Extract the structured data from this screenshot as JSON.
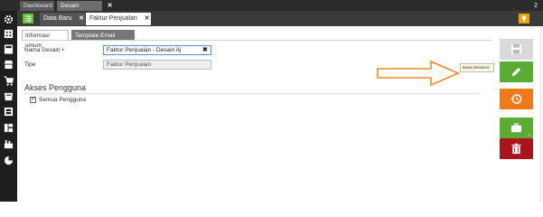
{
  "topbar": {
    "tabs": [
      {
        "label": "Dashboard"
      },
      {
        "label": "Desain Cetakan"
      }
    ],
    "close_label": "✕",
    "right_text": "2"
  },
  "secondbar": {
    "tabs": [
      {
        "label": "Data Baru",
        "close": "✕"
      },
      {
        "label": "Faktur Penjualan ...",
        "close": "✕"
      }
    ]
  },
  "subtabs": [
    {
      "label": "Informasi umum"
    },
    {
      "label": "Template Email Transaksi"
    }
  ],
  "form": {
    "nama_desain": {
      "label": "Nama Desain",
      "required_mark": "•",
      "value": "Faktur Penjualan - Desain A|",
      "clear": "✖"
    },
    "tipe": {
      "label": "Tipe",
      "value": "Faktur Penjualan"
    }
  },
  "access": {
    "title": "Akses Pengguna",
    "checkbox_label": "Semua Pengguna",
    "checked": true
  },
  "tooltip": {
    "text": "Buka Desainer"
  },
  "actions": [
    {
      "name": "save",
      "icon": "floppy-icon"
    },
    {
      "name": "edit",
      "icon": "pencil-icon"
    },
    {
      "name": "history",
      "icon": "history-icon"
    },
    {
      "name": "briefcase",
      "icon": "briefcase-icon"
    },
    {
      "name": "delete",
      "icon": "trash-icon"
    }
  ],
  "sidebar": {
    "icons": [
      "gear-icon",
      "building-icon",
      "calculator-icon",
      "store-icon",
      "cart-icon",
      "database-icon",
      "safe-icon",
      "book-icon",
      "factory-icon",
      "pie-chart-icon"
    ]
  },
  "colors": {
    "green": "#5aac32",
    "orange": "#f07a1a",
    "red": "#a8151c",
    "gray": "#d9d9d9",
    "arrow_orange": "#f08a2a"
  }
}
